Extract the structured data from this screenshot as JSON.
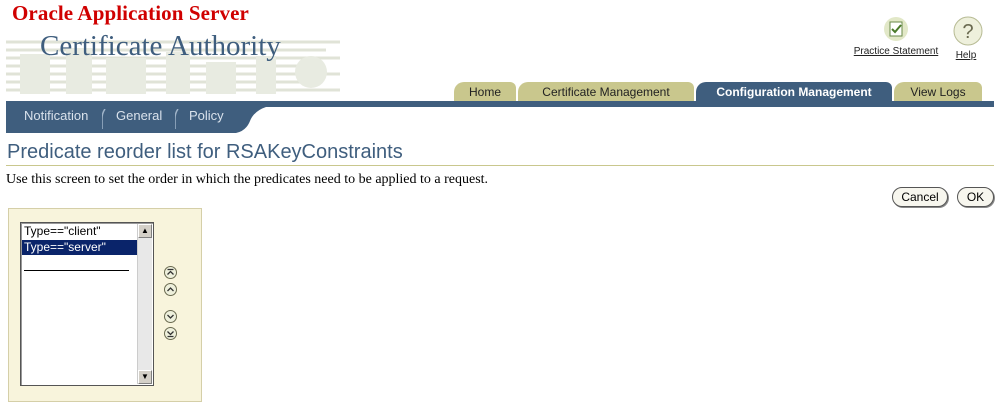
{
  "brand": {
    "product": "Oracle Application Server",
    "component": "Certificate Authority"
  },
  "global_links": {
    "practice_statement": "Practice Statement",
    "help": "Help"
  },
  "tabs": [
    {
      "label": "Home",
      "active": false
    },
    {
      "label": "Certificate Management",
      "active": false
    },
    {
      "label": "Configuration Management",
      "active": true
    },
    {
      "label": "View Logs",
      "active": false
    }
  ],
  "subtabs": [
    {
      "label": "Notification"
    },
    {
      "label": "General"
    },
    {
      "label": "Policy"
    }
  ],
  "page": {
    "title": "Predicate reorder list for RSAKeyConstraints",
    "instructions": "Use this screen to set the order in which the predicates need to be applied to a request."
  },
  "actions": {
    "cancel": "Cancel",
    "ok": "OK"
  },
  "reorder_list": {
    "options": [
      {
        "label": "Type==\"client\"",
        "selected": false
      },
      {
        "label": "Type==\"server\"",
        "selected": true
      }
    ],
    "move_icons": [
      "move-to-top-icon",
      "move-up-icon",
      "move-down-icon",
      "move-to-bottom-icon"
    ]
  },
  "colors": {
    "brand_red": "#d00000",
    "oracle_blue": "#3f5e7e",
    "tab_khaki": "#c9c78d",
    "selection": "#0a246a",
    "panel_bg": "#f8f4dc"
  }
}
